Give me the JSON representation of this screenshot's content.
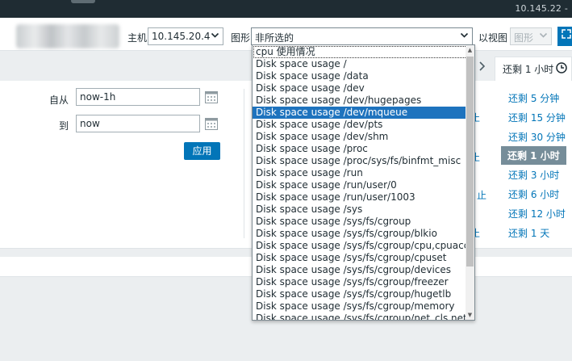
{
  "window": {
    "ip_address": "10.145.22 -"
  },
  "filters": {
    "host_label": "主机",
    "host_value": "10.145.20.4",
    "graph_label": "图形",
    "graph_value": "非所选的",
    "view_label": "以视图",
    "view_value": "图形"
  },
  "time_tab": {
    "label": "还剩 1 小时"
  },
  "time_form": {
    "from_label": "自从",
    "from_value": "now-1h",
    "to_label": "到",
    "to_value": "now",
    "apply_label": "应用"
  },
  "quick_ranges": [
    {
      "label": "还剩 5 分钟",
      "active": false
    },
    {
      "label": "还剩 15 分钟",
      "active": false
    },
    {
      "label": "还剩 30 分钟",
      "active": false
    },
    {
      "label": "还剩 1 小时",
      "active": true
    },
    {
      "label": "还剩 3 小时",
      "active": false
    },
    {
      "label": "还剩 6 小时",
      "active": false
    },
    {
      "label": "还剩 12 小时",
      "active": false
    },
    {
      "label": "还剩 1 天",
      "active": false
    }
  ],
  "partial_labels": [
    "止",
    "止",
    "止",
    "止"
  ],
  "graph_options": [
    "cpu 使用情况",
    "Disk space usage /",
    "Disk space usage /data",
    "Disk space usage /dev",
    "Disk space usage /dev/hugepages",
    "Disk space usage /dev/mqueue",
    "Disk space usage /dev/pts",
    "Disk space usage /dev/shm",
    "Disk space usage /proc",
    "Disk space usage /proc/sys/fs/binfmt_misc",
    "Disk space usage /run",
    "Disk space usage /run/user/0",
    "Disk space usage /run/user/1003",
    "Disk space usage /sys",
    "Disk space usage /sys/fs/cgroup",
    "Disk space usage /sys/fs/cgroup/blkio",
    "Disk space usage /sys/fs/cgroup/cpu,cpuacct",
    "Disk space usage /sys/fs/cgroup/cpuset",
    "Disk space usage /sys/fs/cgroup/devices",
    "Disk space usage /sys/fs/cgroup/freezer",
    "Disk space usage /sys/fs/cgroup/hugetlb",
    "Disk space usage /sys/fs/cgroup/memory",
    "Disk space usage /sys/fs/cgroup/net_cls,net_prio"
  ],
  "selected_option_index": 5,
  "icons": {
    "calendar": "calendar-icon",
    "clock": "clock-icon",
    "expand": "fullscreen-icon",
    "chevron": "chevron-down-icon"
  }
}
